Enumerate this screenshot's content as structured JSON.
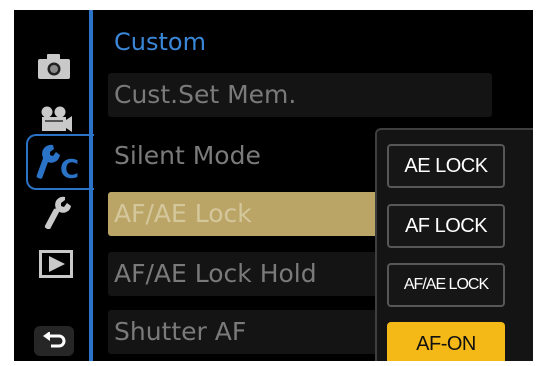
{
  "sidebar": {
    "icons": [
      "camera-icon",
      "video-camera-icon",
      "custom-wrench-c-icon",
      "wrench-icon",
      "playback-icon",
      "return-icon"
    ],
    "custom_tab_letter": "C"
  },
  "menu": {
    "title": "Custom",
    "items": [
      {
        "label": "Cust.Set Mem."
      },
      {
        "label": "Silent Mode"
      },
      {
        "label": "AF/AE Lock"
      },
      {
        "label": "AF/AE Lock Hold"
      },
      {
        "label": "Shutter AF"
      }
    ],
    "selected_index": 2
  },
  "popup": {
    "options": [
      {
        "label": "AE LOCK"
      },
      {
        "label": "AF LOCK"
      },
      {
        "label": "AF/AE LOCK"
      },
      {
        "label": "AF-ON"
      }
    ],
    "selected_index": 3
  },
  "colors": {
    "accent_blue": "#2a73c7",
    "highlight_tan": "#bba566",
    "selected_yellow": "#f5b917"
  }
}
